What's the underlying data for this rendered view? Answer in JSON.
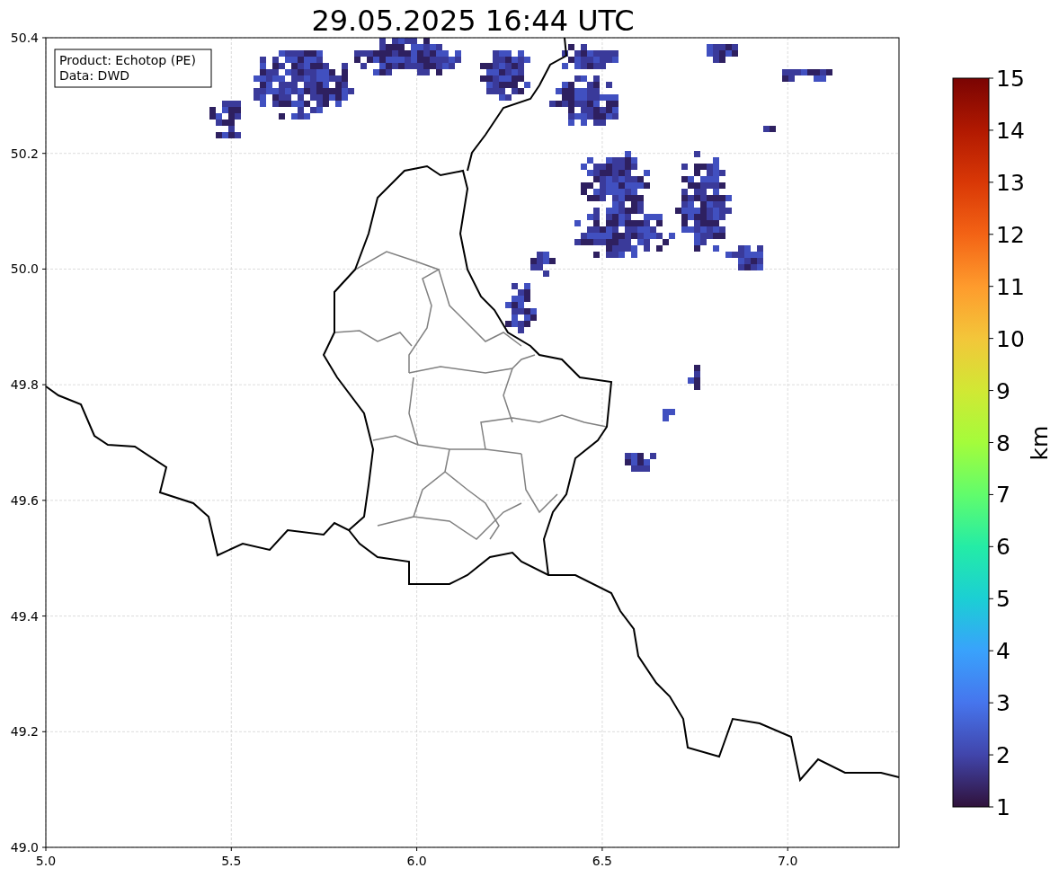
{
  "title": "29.05.2025 16:44 UTC",
  "info_box": [
    "Product: Echotop (PE)",
    "Data: DWD"
  ],
  "x_axis": {
    "ticks": [
      "5.0",
      "5.5",
      "6.0",
      "6.5",
      "7.0"
    ]
  },
  "y_axis": {
    "ticks": [
      "50.4",
      "50.2",
      "50.0",
      "49.8",
      "49.6",
      "49.4",
      "49.2",
      "49.0"
    ]
  },
  "colorbar": {
    "label": "km",
    "ticks": [
      "15",
      "14",
      "13",
      "12",
      "11",
      "10",
      "9",
      "8",
      "7",
      "6",
      "5",
      "4",
      "3",
      "2",
      "1"
    ]
  }
}
